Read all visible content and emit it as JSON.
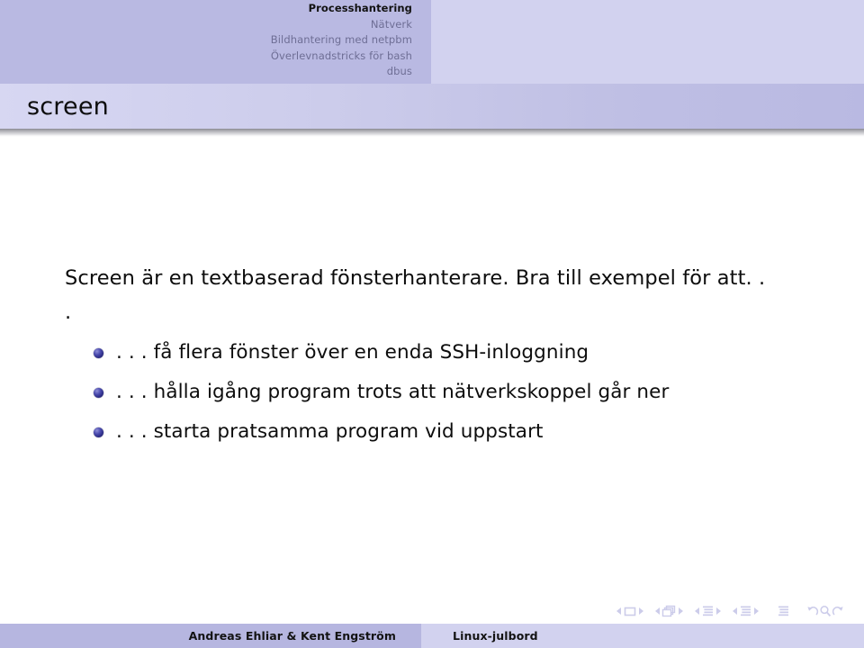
{
  "header": {
    "nav_items": [
      {
        "label": "Processhantering",
        "active": true
      },
      {
        "label": "Nätverk",
        "active": false
      },
      {
        "label": "Bildhantering med netpbm",
        "active": false
      },
      {
        "label": "Överlevnadstricks för bash",
        "active": false
      },
      {
        "label": "dbus",
        "active": false
      }
    ],
    "colors": {
      "nav_bar_left": "#b9b9e2",
      "nav_bar_right": "#d2d2ef",
      "active_text": "#121212",
      "inactive_text": "#6e6e95"
    }
  },
  "title": {
    "frametitle": "screen",
    "bar_color_start": "#d7d7f2",
    "bar_color_end": "#b9b9e2"
  },
  "content": {
    "intro": "Screen är en textbaserad fönsterhanterare. Bra till exempel för att. . .",
    "bullets": [
      {
        "text": ". . . få flera fönster över en enda SSH-inloggning"
      },
      {
        "text": ". . . hålla igång program trots att nätverkskoppel går ner"
      },
      {
        "text": ". . . starta pratsamma program vid uppstart"
      }
    ],
    "bullet_color": "#2a2a82"
  },
  "navigation_symbols": {
    "groups": [
      {
        "icon": "slide-icon",
        "prev": "prev-slide-triangle",
        "next": "next-slide-triangle"
      },
      {
        "icon": "frame-icon",
        "prev": "prev-frame-triangle",
        "next": "next-frame-triangle"
      },
      {
        "icon": "subsection-icon",
        "prev": "prev-subsection-triangle",
        "next": "next-subsection-triangle"
      },
      {
        "icon": "section-icon",
        "prev": "prev-section-triangle",
        "next": "next-section-triangle"
      }
    ],
    "presentation_icon": "presentation-icon",
    "back_icon": "back-arrow-icon",
    "search_icon": "search-icon",
    "forward_icon": "forward-arrow-icon",
    "color": "#ccccea"
  },
  "footer": {
    "authors": "Andreas Ehliar & Kent Engström",
    "event": "Linux-julbord",
    "left_bg": "#b6b6e0",
    "right_bg": "#d2d2ef"
  }
}
